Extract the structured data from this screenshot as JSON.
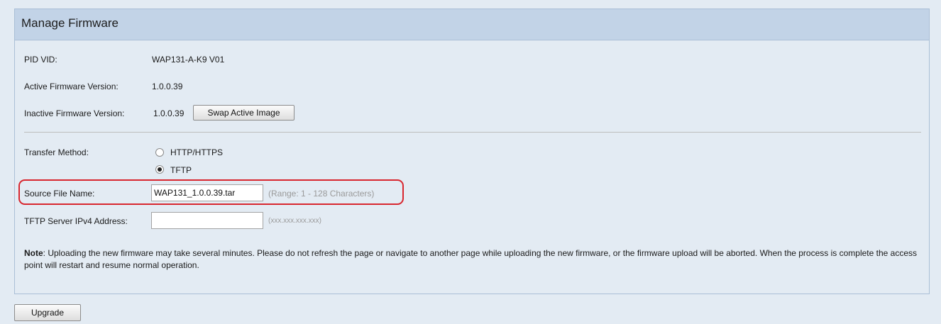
{
  "header": {
    "title": "Manage Firmware"
  },
  "info": {
    "pid_vid_label": "PID VID:",
    "pid_vid_value": "WAP131-A-K9 V01",
    "active_label": "Active Firmware Version:",
    "active_value": "1.0.0.39",
    "inactive_label": "Inactive Firmware Version:",
    "inactive_value": "1.0.0.39",
    "swap_button": "Swap Active Image"
  },
  "transfer": {
    "label": "Transfer Method:",
    "options": [
      {
        "label": "HTTP/HTTPS",
        "selected": false
      },
      {
        "label": "TFTP",
        "selected": true
      }
    ]
  },
  "source_file": {
    "label": "Source File Name:",
    "value": "WAP131_1.0.0.39.tar",
    "hint": "(Range: 1 - 128 Characters)"
  },
  "tftp_server": {
    "label": "TFTP Server IPv4 Address:",
    "value": "",
    "hint": "(xxx.xxx.xxx.xxx)"
  },
  "note": {
    "bold": "Note",
    "text": ": Uploading the new firmware may take several minutes. Please do not refresh the page or navigate to another page while uploading the new firmware, or the firmware upload will be aborted. When the process is complete the access point will restart and resume normal operation."
  },
  "upgrade_button": "Upgrade",
  "colors": {
    "header_bg": "#c2d3e7",
    "panel_bg": "#e3ebf3",
    "highlight": "#d8262e"
  }
}
